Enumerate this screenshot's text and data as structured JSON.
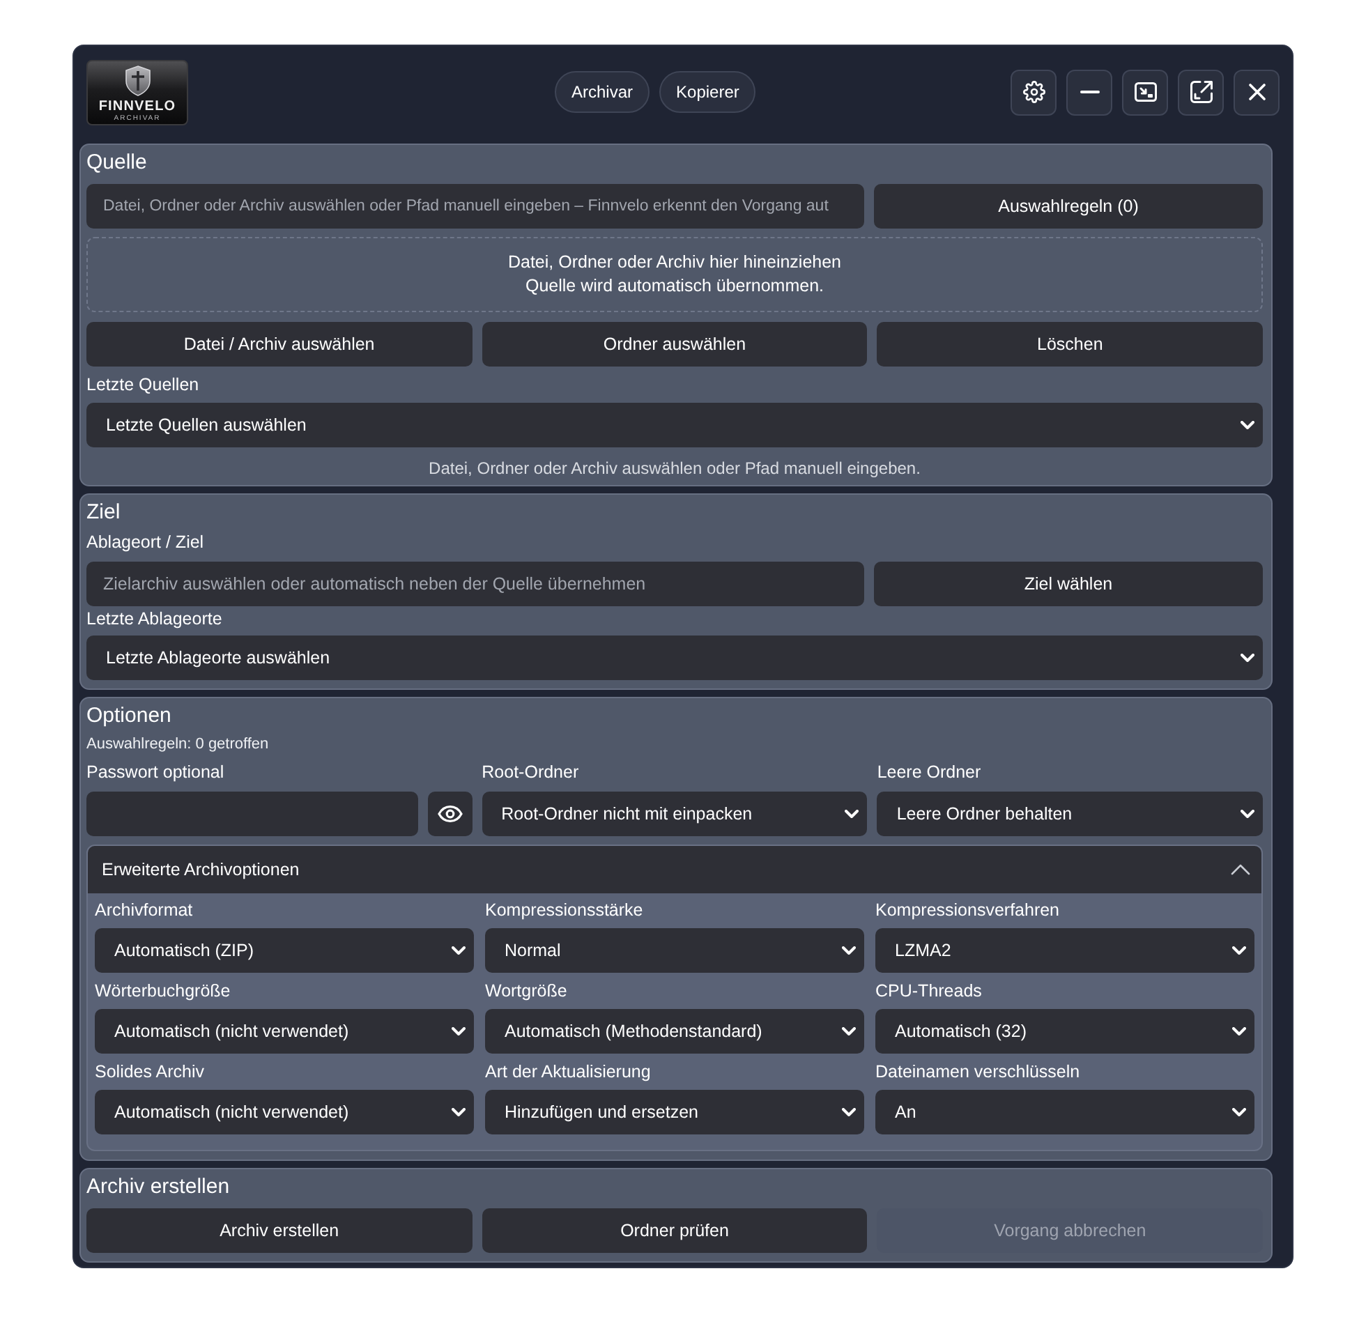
{
  "header": {
    "logo": {
      "name": "FINNVELO",
      "tagline": "ARCHIVAR"
    },
    "modes": [
      "Archivar",
      "Kopierer"
    ]
  },
  "source": {
    "title": "Quelle",
    "path_input": {
      "placeholder": "Datei, Ordner oder Archiv auswählen oder Pfad manuell eingeben – Finnvelo erkennt den Vorgang aut"
    },
    "rules_button": "Auswahlregeln (0)",
    "drop_zone": {
      "lines": [
        "Datei, Ordner oder Archiv hier hineinziehen",
        "Quelle wird automatisch übernommen."
      ]
    },
    "buttons": [
      "Datei / Archiv auswählen",
      "Ordner auswählen",
      "Löschen"
    ],
    "recent": {
      "label": "Letzte Quellen",
      "value": "Letzte Quellen auswählen"
    },
    "hint": "Datei, Ordner oder Archiv auswählen oder Pfad manuell eingeben."
  },
  "target": {
    "title": "Ziel",
    "location_label": "Ablageort / Ziel",
    "path_input": {
      "placeholder": "Zielarchiv auswählen oder automatisch neben der Quelle übernehmen"
    },
    "choose_button": "Ziel wählen",
    "recent": {
      "label": "Letzte Ablageorte",
      "value": "Letzte Ablageorte auswählen"
    }
  },
  "options": {
    "title": "Optionen",
    "rules_summary": "Auswahlregeln: 0 getroffen",
    "fields": [
      {
        "kind": "password",
        "label": "Passwort optional"
      },
      {
        "kind": "select",
        "label": "Root-Ordner",
        "value": "Root-Ordner nicht mit einpacken"
      },
      {
        "kind": "select",
        "label": "Leere Ordner",
        "value": "Leere Ordner behalten"
      }
    ],
    "advanced": {
      "title": "Erweiterte Archivoptionen",
      "expanded": true,
      "fields": [
        {
          "label": "Archivformat",
          "value": "Automatisch (ZIP)"
        },
        {
          "label": "Kompressionsstärke",
          "value": "Normal"
        },
        {
          "label": "Kompressionsverfahren",
          "value": "LZMA2"
        },
        {
          "label": "Wörterbuchgröße",
          "value": "Automatisch (nicht verwendet)"
        },
        {
          "label": "Wortgröße",
          "value": "Automatisch (Methodenstandard)"
        },
        {
          "label": "CPU-Threads",
          "value": "Automatisch (32)"
        },
        {
          "label": "Solides Archiv",
          "value": "Automatisch (nicht verwendet)"
        },
        {
          "label": "Art der Aktualisierung",
          "value": "Hinzufügen und ersetzen"
        },
        {
          "label": "Dateinamen verschlüsseln",
          "value": "An"
        }
      ]
    }
  },
  "create": {
    "title": "Archiv erstellen",
    "buttons": [
      {
        "label": "Archiv erstellen",
        "disabled": false
      },
      {
        "label": "Ordner prüfen",
        "disabled": false
      },
      {
        "label": "Vorgang abbrechen",
        "disabled": true
      }
    ]
  }
}
